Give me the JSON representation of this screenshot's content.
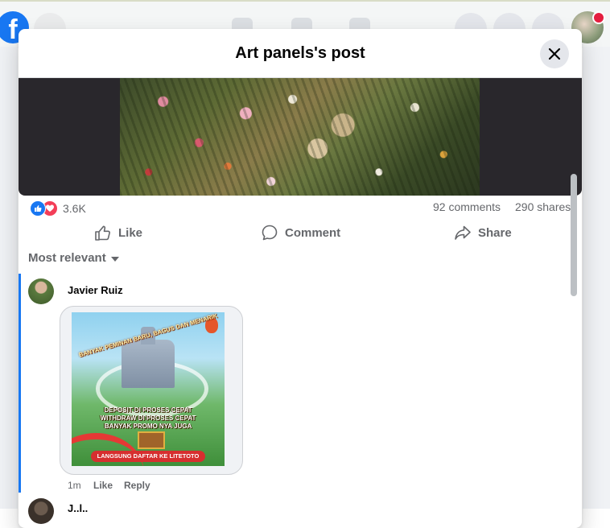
{
  "modal": {
    "title": "Art panels's post",
    "close_label": ""
  },
  "post": {
    "reaction_count": "3.6K",
    "comments_count": "92 comments",
    "shares_count": "290 shares",
    "actions": {
      "like": "Like",
      "comment": "Comment",
      "share": "Share"
    }
  },
  "comments": {
    "sort_label": "Most relevant",
    "items": [
      {
        "author": "Javier Ruiz",
        "time": "1m",
        "like": "Like",
        "reply": "Reply",
        "attachment": {
          "banner": "BANYAK PEMINAN BARU, BAGUS DAN MENARIK",
          "line1": "DEPOSIT DI PROSES CEPAT",
          "line2": "WITHDRAW DI PROSES CEPAT",
          "line3": "BANYAK PROMO NYA JUGA",
          "footer": "LANGSUNG DAFTAR KE LITETOTO"
        }
      },
      {
        "author": "J..l.."
      }
    ]
  },
  "colors": {
    "brand": "#1877f2",
    "love": "#f33e58",
    "muted_text": "#65676b"
  },
  "icons": [
    "facebook-logo-icon",
    "search-icon",
    "home-icon",
    "friends-icon",
    "groups-icon",
    "menu-grid-icon",
    "messenger-icon",
    "bell-icon",
    "close-icon",
    "like-reaction-icon",
    "love-reaction-icon",
    "thumbs-up-icon",
    "comment-icon",
    "share-icon",
    "caret-down-icon"
  ]
}
